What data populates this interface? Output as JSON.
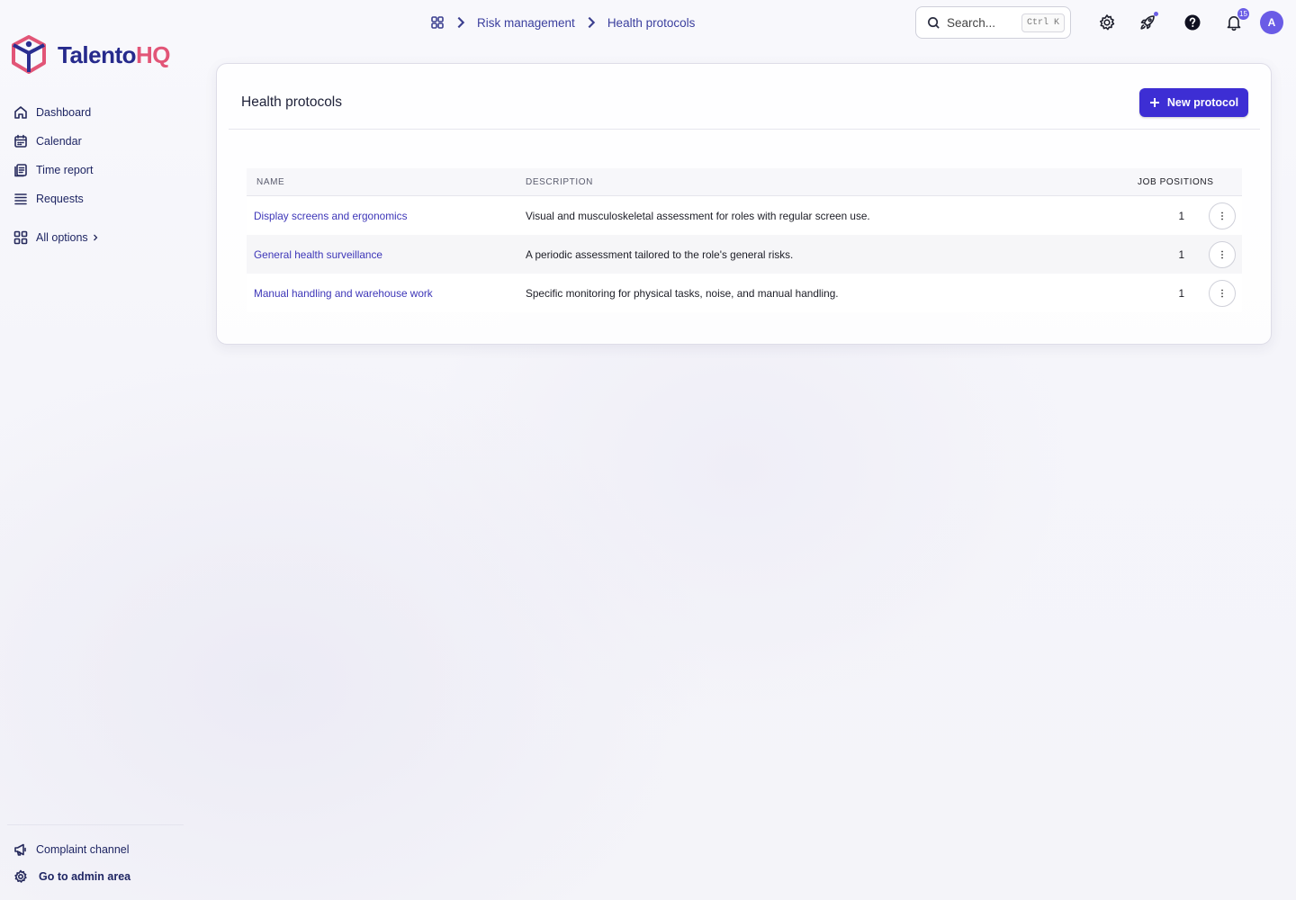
{
  "brand": {
    "name_main": "Talento",
    "name_accent": "HQ",
    "primary": "#262a8c",
    "accent": "#e25577"
  },
  "sidebar": {
    "items": [
      {
        "label": "Dashboard",
        "icon": "home-icon"
      },
      {
        "label": "Calendar",
        "icon": "calendar-icon"
      },
      {
        "label": "Time report",
        "icon": "report-icon"
      },
      {
        "label": "Requests",
        "icon": "list-icon"
      }
    ],
    "all_options": "All options",
    "bottom": [
      {
        "label": "Complaint channel",
        "icon": "megaphone-icon"
      },
      {
        "label": "Go to admin area",
        "icon": "gear-icon"
      }
    ]
  },
  "header": {
    "breadcrumb": [
      "Risk management",
      "Health protocols"
    ],
    "search_placeholder": "Search...",
    "search_shortcut": "Ctrl K",
    "notifications_count": "15",
    "avatar_initial": "A"
  },
  "main": {
    "title": "Health protocols",
    "new_button": "New protocol",
    "columns": {
      "name": "NAME",
      "description": "DESCRIPTION",
      "job_positions": "JOB POSITIONS"
    },
    "rows": [
      {
        "name": "Display screens and ergonomics",
        "description": "Visual and musculoskeletal assessment for roles with regular screen use.",
        "job_positions": "1"
      },
      {
        "name": "General health surveillance",
        "description": "A periodic assessment tailored to the role's general risks.",
        "job_positions": "1"
      },
      {
        "name": "Manual handling and warehouse work",
        "description": "Specific monitoring for physical tasks, noise, and manual handling.",
        "job_positions": "1"
      }
    ]
  }
}
